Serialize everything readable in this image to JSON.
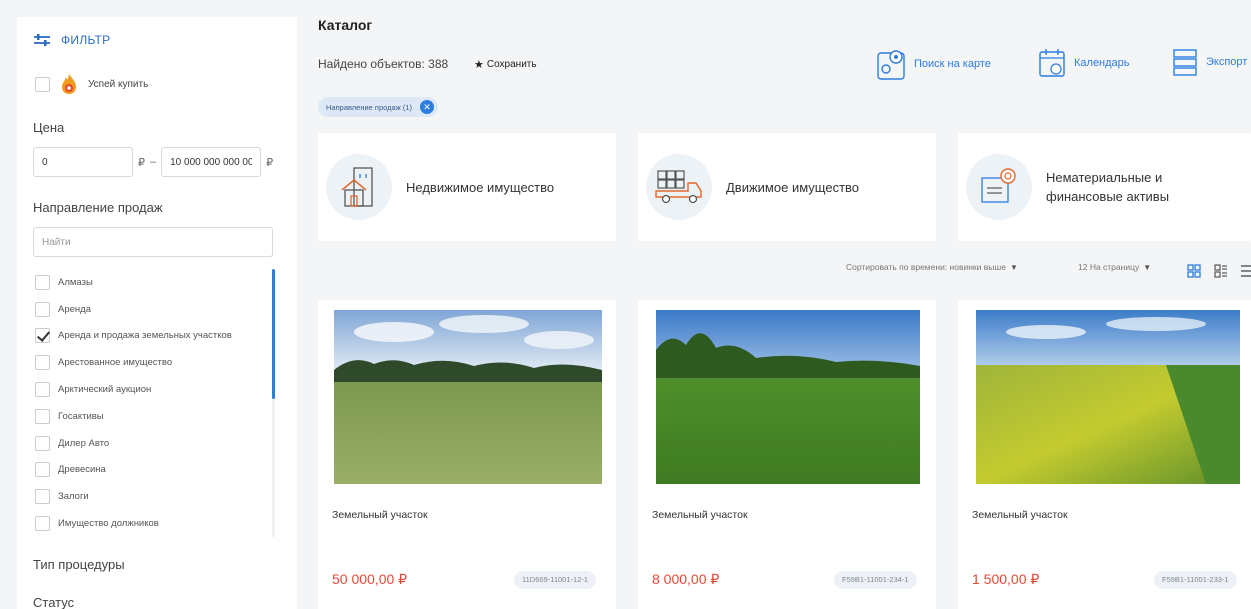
{
  "sidebar": {
    "filter_label": "ФИЛЬТР",
    "hurry_label": "Успей купить",
    "price_title": "Цена",
    "price_from": "0",
    "price_to": "10 000 000 000 00",
    "currency": "₽",
    "price_dash": "–",
    "direction_title": "Направление продаж",
    "search_placeholder": "Найти",
    "directions": [
      {
        "label": "Алмазы",
        "checked": false
      },
      {
        "label": "Аренда",
        "checked": false
      },
      {
        "label": "Аренда и продажа земельных участков",
        "checked": true
      },
      {
        "label": "Арестованное имущество",
        "checked": false
      },
      {
        "label": "Арктический аукцион",
        "checked": false
      },
      {
        "label": "Госактивы",
        "checked": false
      },
      {
        "label": "Дилер Авто",
        "checked": false
      },
      {
        "label": "Древесина",
        "checked": false
      },
      {
        "label": "Залоги",
        "checked": false
      },
      {
        "label": "Имущество должников",
        "checked": false
      }
    ],
    "procedure_title": "Тип процедуры",
    "status_title": "Статус"
  },
  "main": {
    "title": "Каталог",
    "found": "Найдено объектов: 388",
    "save_label": "Сохранить",
    "tools": {
      "map": "Поиск на карте",
      "calendar": "Календарь",
      "export": "Экспорт"
    },
    "chip_label": "Направление продаж (1)",
    "categories": [
      {
        "label_1": "Недвижимое имущество",
        "label_2": ""
      },
      {
        "label_1": "Движимое имущество",
        "label_2": ""
      },
      {
        "label_1": "Нематериальные и",
        "label_2": "финансовые активы"
      }
    ],
    "sort_label": "Сортировать по времени: новинки выше",
    "per_page_label": "12 На страницу",
    "cards": [
      {
        "title": "Земельный участок",
        "price": "50 000,00 ₽",
        "code": "11D669-11001-12-1"
      },
      {
        "title": "Земельный участок",
        "price": "8 000,00 ₽",
        "code": "F59B1-11001-234-1"
      },
      {
        "title": "Земельный участок",
        "price": "1 500,00 ₽",
        "code": "F59B1-11001-233-1"
      }
    ]
  },
  "colors": {
    "accent": "#2b7de0",
    "price": "#e04b3a",
    "background": "#f4f5f7"
  }
}
